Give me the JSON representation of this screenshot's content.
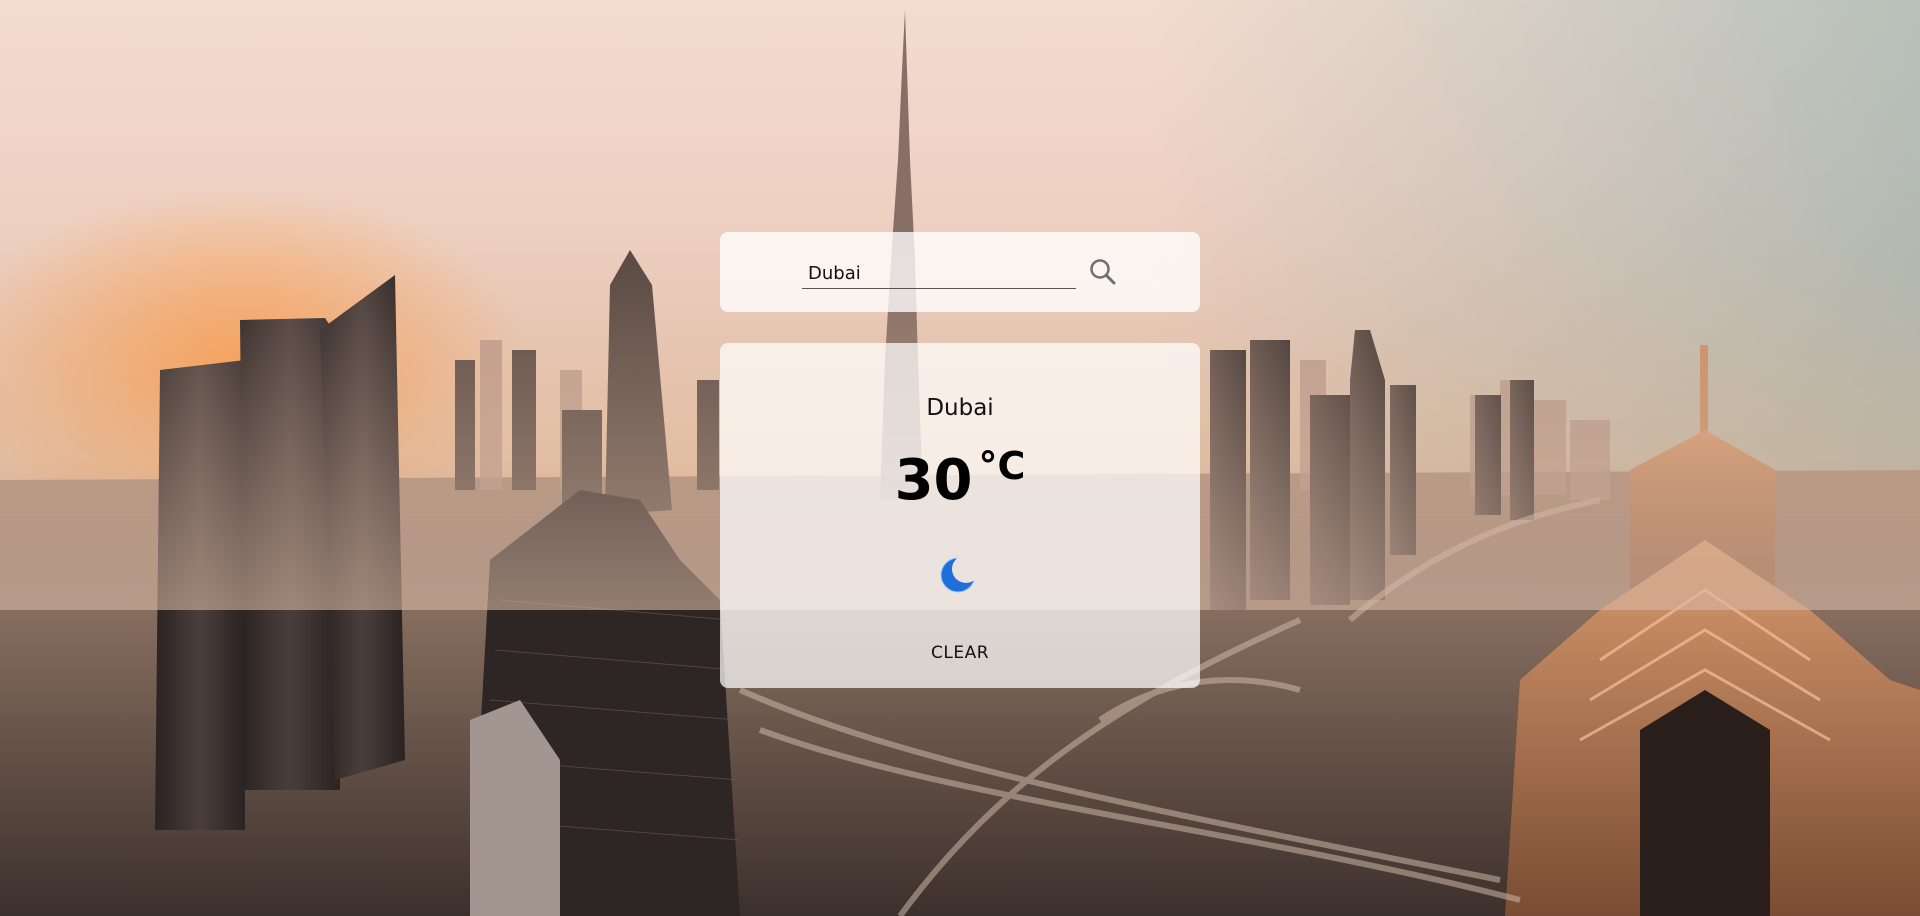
{
  "search": {
    "value": "Dubai",
    "icon": "search-icon"
  },
  "weather": {
    "city": "Dubai",
    "temperature": "30",
    "unit": "°C",
    "icon": "moon-icon",
    "description": "CLEAR"
  },
  "colors": {
    "card_bg": "#ffffff",
    "moon_fill": "#1e6fd9"
  }
}
